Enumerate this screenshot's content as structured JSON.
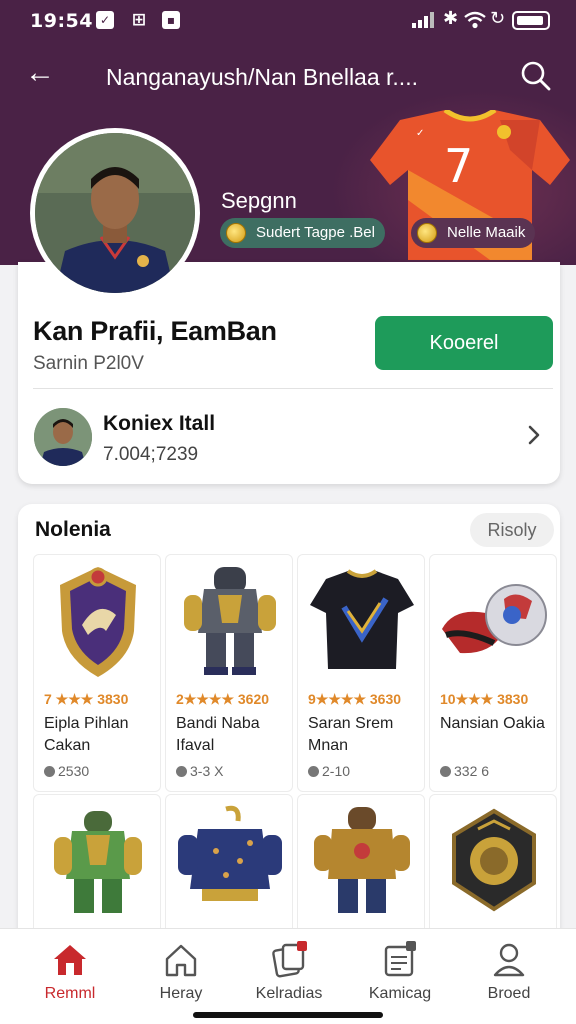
{
  "status_bar": {
    "time": "19:54"
  },
  "header": {
    "title": "Nanganayush/Nan Bnellaa r...."
  },
  "banner": {
    "name": "Sepgnn",
    "chip_left": "Sudert Tagpe .Bel",
    "chip_right": "Nelle Maaik",
    "jersey_number": "7"
  },
  "profile": {
    "name": "Kan Prafii, EamBan",
    "subtitle": "Sarnin P2l0V",
    "follow_label": "Kooerel"
  },
  "friend": {
    "name": "Koniex Itall",
    "subtitle": "7.004;7239"
  },
  "items_section": {
    "title": "Nolenia",
    "filter_label": "Risoly",
    "items": [
      {
        "rating": "7 ★★★ 3830",
        "name": "Eipla Pihlan Cakan",
        "price": "2530",
        "icon": "crest-badge-icon"
      },
      {
        "rating": "2★★★★ 3620",
        "name": "Bandi Naba Ifaval",
        "price": "3-3 X",
        "icon": "armor-suit-icon"
      },
      {
        "rating": "9★★★★ 3630",
        "name": "Saran Srem Mnan",
        "price": "2-10",
        "icon": "jersey-icon"
      },
      {
        "rating": "10★★★ 3830",
        "name": "Nansian Oakia",
        "price": "332 6",
        "icon": "football-boot-icon"
      },
      {
        "rating": "",
        "name": "",
        "price": "",
        "icon": "green-suit-icon"
      },
      {
        "rating": "",
        "name": "",
        "price": "",
        "icon": "blue-jacket-icon"
      },
      {
        "rating": "",
        "name": "",
        "price": "",
        "icon": "gold-suit-icon"
      },
      {
        "rating": "",
        "name": "",
        "price": "",
        "icon": "medal-shield-icon"
      }
    ]
  },
  "bottom_nav": [
    {
      "label": "Remml",
      "icon": "home-icon",
      "active": true
    },
    {
      "label": "Heray",
      "icon": "house-outline-icon",
      "active": false
    },
    {
      "label": "Kelradias",
      "icon": "cards-icon",
      "active": false
    },
    {
      "label": "Kamicag",
      "icon": "calendar-icon",
      "active": false
    },
    {
      "label": "Broed",
      "icon": "profile-icon",
      "active": false
    }
  ],
  "colors": {
    "header": "#4a2246",
    "accent_green": "#1e9b5a",
    "active_red": "#c8292d",
    "rating_orange": "#e0892a"
  }
}
